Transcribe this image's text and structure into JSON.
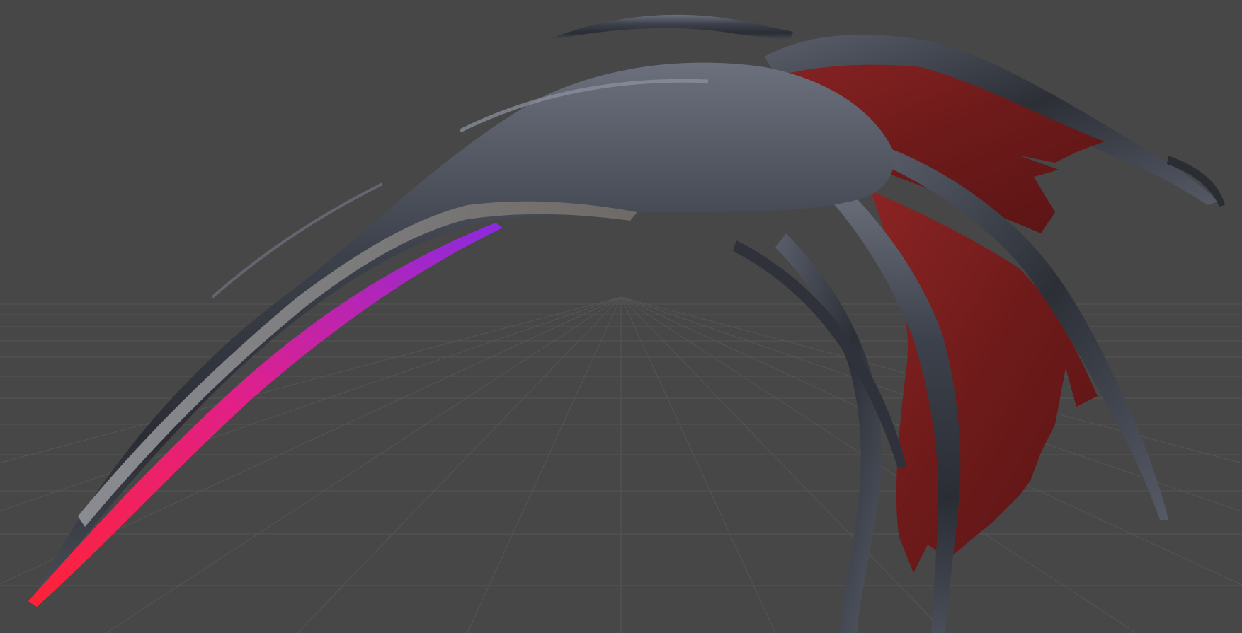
{
  "viewport": {
    "background_color": "#474747",
    "grid_color": "#585858"
  },
  "model": {
    "metal_color": "#3a3d45",
    "metal_highlight": "#9aa0ab",
    "membrane_color": "#7a1f1f",
    "edge_gradient": [
      "#ff2235",
      "#e0208a",
      "#8a2ae0"
    ]
  }
}
